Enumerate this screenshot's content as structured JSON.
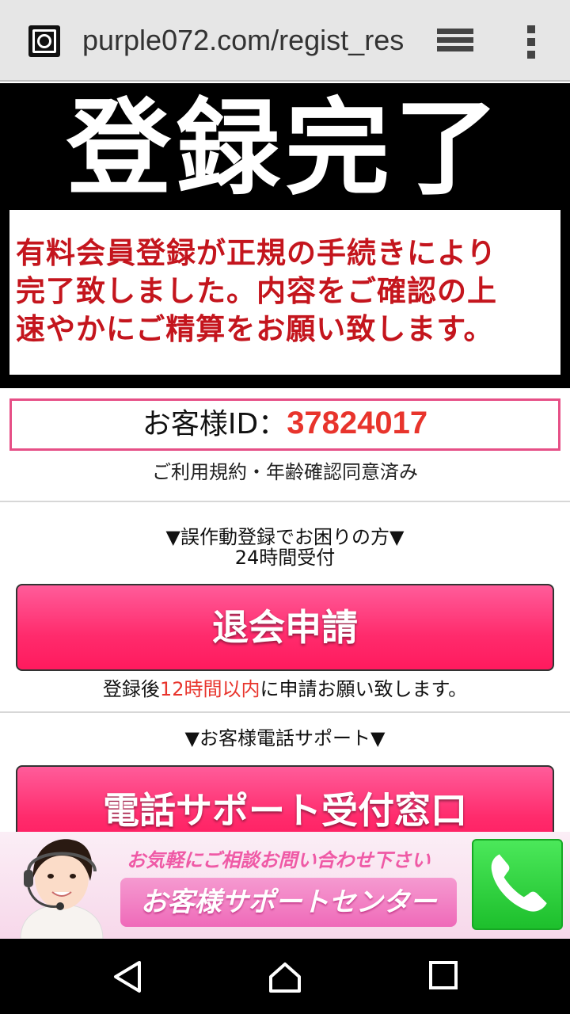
{
  "browser": {
    "url": "purple072.com/regist_res"
  },
  "hero": {
    "title": "登録完了",
    "message_lines": [
      "有料会員登録が正規の手続きにより",
      "完了致しました。内容をご確認の上",
      "速やかにご精算をお願い致します。"
    ]
  },
  "customer": {
    "id_label": "お客様ID：",
    "id_value": "37824017",
    "agreement": "ご利用規約・年齢確認同意済み"
  },
  "withdraw_section": {
    "title": "▼誤作動登録でお困りの方▼",
    "subtitle": "24時間受付",
    "button_label": "退会申請",
    "note_before": "登録後",
    "note_highlight": "12時間以内",
    "note_after": "に申請お願い致します。"
  },
  "phone_section": {
    "title": "▼お客様電話サポート▼",
    "button_label": "電話サポート受付窓口"
  },
  "banner": {
    "tagline": "お気軽にご相談お問い合わせ下さい",
    "center_label": "お客様サポートセンター"
  },
  "colors": {
    "accent_pink": "#ff2b6c",
    "id_red": "#e8342c",
    "hero_red": "#c4151d",
    "phone_green": "#1dbf2c"
  }
}
